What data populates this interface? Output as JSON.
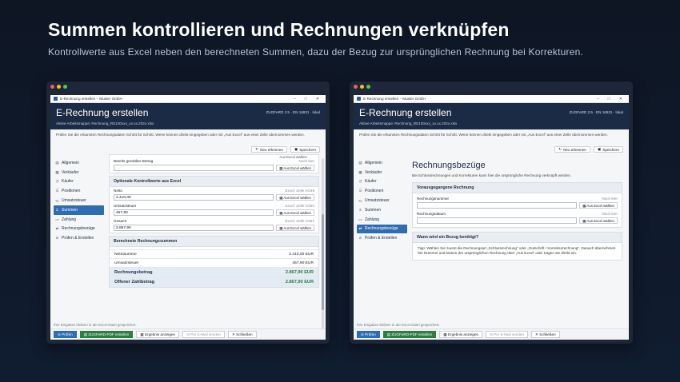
{
  "headline": "Summen kontrollieren und Rechnungen verknüpfen",
  "subline": "Kontrollwerte aus Excel neben den berechneten Summen, dazu der Bezug zur ursprünglichen Rechnung bei Korrekturen.",
  "window": {
    "title": "E-Rechnung erstellen – Muster GmbH",
    "minimize": "–",
    "maximize": "□",
    "close": "✕"
  },
  "app": {
    "title": "E-Rechnung erstellen",
    "version": "ZUGFeRD 2.5 · EN 16931 · lokal",
    "workbook": "Aktive Arbeitsmappe: Rechnung_RE100xxx_xx.xx.202x.xlsx",
    "intro": "Prüfen Sie die erkannten Rechnungsdaten Schritt für Schritt. Werte können direkt eingegeben oder mit „Aus Excel\" aus einer Zelle übernommen werden."
  },
  "actions": {
    "recognize": "Neu erkennen",
    "save": "Speichern"
  },
  "sidebar": [
    {
      "label": "Allgemein",
      "icon": "▤"
    },
    {
      "label": "Verkäufer",
      "icon": "▦"
    },
    {
      "label": "Käufer",
      "icon": "◷"
    },
    {
      "label": "Positionen",
      "icon": "☰"
    },
    {
      "label": "Umsatzsteuer",
      "icon": "%"
    },
    {
      "label": "Summen",
      "icon": "Σ"
    },
    {
      "label": "Zahlung",
      "icon": "▭"
    },
    {
      "label": "Rechnungsbezüge",
      "icon": "⇄"
    },
    {
      "label": "Prüfen & Erstellen",
      "icon": "⊘"
    }
  ],
  "left": {
    "active": "Summen",
    "partial": {
      "label": "Bereits gezahlter Betrag",
      "hint": "Noch leer",
      "btn": "Aus Excel wählen",
      "btn_top": "Aus Excel wählen"
    },
    "control": {
      "title": "Optionale Kontrollwerte aus Excel",
      "fields": [
        {
          "label": "Netto",
          "hint": "Excel: Zelle AO49",
          "value": "2.410,00",
          "btn": "Aus Excel wählen"
        },
        {
          "label": "Umsatzsteuer",
          "hint": "Excel: Zelle AO50",
          "value": "457,90",
          "btn": "Aus Excel wählen"
        },
        {
          "label": "Gesamt",
          "hint": "Excel: Zelle AO51",
          "value": "2.867,90",
          "btn": "Aus Excel wählen"
        }
      ]
    },
    "sums": {
      "title": "Berechnete Rechnungssummen",
      "rows": [
        {
          "label": "Nettosumme",
          "value": "2.410,00 EUR"
        },
        {
          "label": "Umsatzsteuer",
          "value": "457,90 EUR"
        }
      ],
      "big": [
        {
          "label": "Rechnungsbetrag",
          "value": "2.867,90 EUR"
        },
        {
          "label": "Offener Zahlbetrag",
          "value": "2.867,90 EUR"
        }
      ]
    }
  },
  "right": {
    "active": "Rechnungsbezüge",
    "title": "Rechnungsbezüge",
    "desc": "Bei Schlussrechnungen und Korrekturen kann hier die ursprüngliche Rechnung verknüpft werden.",
    "prev": {
      "title": "Vorausgegangene Rechnung",
      "fields": [
        {
          "label": "Rechnungsnummer",
          "hint": "Noch leer",
          "btn": "Aus Excel wählen"
        },
        {
          "label": "Rechnungsdatum",
          "hint": "Noch leer",
          "btn": "Aus Excel wählen"
        }
      ]
    },
    "when": {
      "title": "Wann wird ein Bezug benötigt?",
      "tip": "Tipp: Wählen Sie zuerst die Rechnungsart „Schlussrechnung\" oder „Gutschrift / Korrekturrechnung\". Danach übernehmen Sie Nummer und Datum der ursprünglichen Rechnung über „Aus Excel\" oder tragen sie direkt ein."
    }
  },
  "footer": {
    "note": "Ihre Eingaben bleiben in der Excel-Datei gespeichert.",
    "check": "Prüfen",
    "create": "ZUGFeRD-PDF erstellen",
    "show": "Ergebnis anzeigen",
    "mail": "Per E-Mail senden",
    "close": "Schließen"
  },
  "colors": {
    "header": "#1c2b45",
    "accent": "#2f6db0",
    "green": "#2f7d43"
  }
}
